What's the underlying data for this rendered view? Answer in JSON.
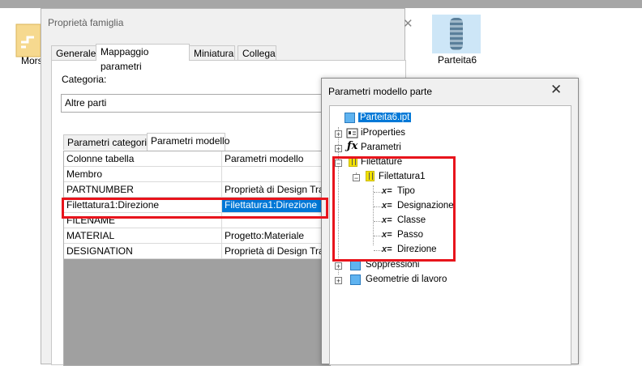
{
  "desktop": {
    "left_icon_label": "Mors",
    "right_icon_label": "Parteita6"
  },
  "family_dialog": {
    "title": "Proprietà famiglia",
    "tabs": [
      "Generale",
      "Mappaggio parametri",
      "Miniatura",
      "Collega"
    ],
    "active_tab": "Mappaggio parametri",
    "category_label": "Categoria:",
    "category_value": "Altre parti",
    "subtabs": [
      "Parametri categoria",
      "Parametri modello"
    ],
    "active_subtab": "Parametri modello",
    "grid": {
      "headers": [
        "Colonne tabella",
        "Parametri modello"
      ],
      "rows": [
        {
          "col": "Membro",
          "param": ""
        },
        {
          "col": "PARTNUMBER",
          "param": "Proprietà di Design Trac..."
        },
        {
          "col": "Filettatura1:Direzione",
          "param": "Filettatura1:Direzione",
          "selected": true
        },
        {
          "col": "FILENAME",
          "param": ""
        },
        {
          "col": "MATERIAL",
          "param": "Progetto:Materiale"
        },
        {
          "col": "DESIGNATION",
          "param": "Proprietà di Design Trac..."
        }
      ]
    }
  },
  "tree_dialog": {
    "title": "Parametri modello parte",
    "root": "Parteita6.ipt",
    "items": {
      "iproperties": "iProperties",
      "parametri": "Parametri",
      "filettature": "Filettature",
      "filettatura1": "Filettatura1",
      "tipo": "Tipo",
      "designazione": "Designazione",
      "classe": "Classe",
      "passo": "Passo",
      "direzione": "Direzione",
      "soppressioni": "Soppressioni",
      "geometrie": "Geometrie di lavoro"
    }
  },
  "colors": {
    "selection": "#0078d7",
    "highlight_box": "#e8141c",
    "dialog_bg": "#f0f0f0"
  }
}
